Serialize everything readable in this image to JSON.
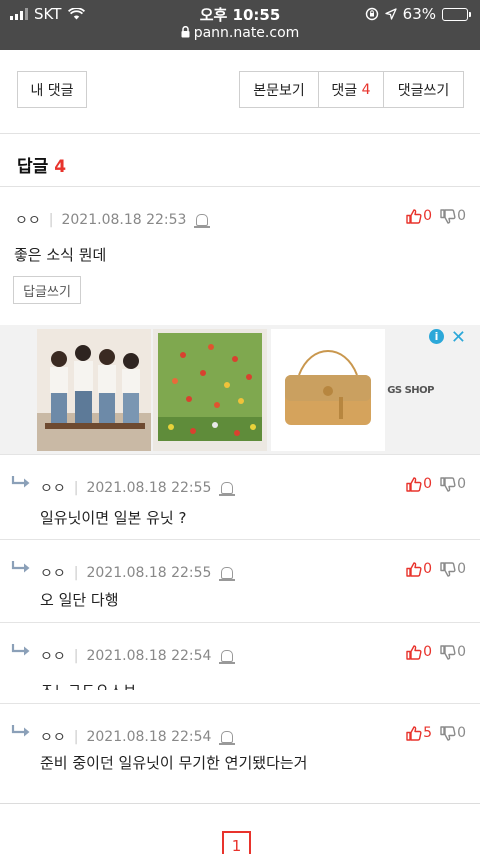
{
  "status_bar": {
    "carrier": "SKT",
    "time": "오후 10:55",
    "url": "pann.nate.com",
    "battery": "63%",
    "battery_level": 0.63
  },
  "toolbar": {
    "my_comments": "내 댓글",
    "view_post": "본문보기",
    "comments_label": "댓글",
    "comments_count": "4",
    "write_comment": "댓글쓰기"
  },
  "replies_section": {
    "title": "답글",
    "count": "4"
  },
  "comments": [
    {
      "author": "ㅇㅇ",
      "date": "2021.08.18 22:53",
      "text": "좋은 소식 뭔데",
      "up": "0",
      "down": "0",
      "reply_label": "답글쓰기"
    },
    {
      "author": "ㅇㅇ",
      "date": "2021.08.18 22:55",
      "text": "일유닛이면 일본 유닛 ?",
      "up": "0",
      "down": "0"
    },
    {
      "author": "ㅇㅇ",
      "date": "2021.08.18 22:55",
      "text": "오 일단 다행",
      "up": "0",
      "down": "0"
    },
    {
      "author": "ㅇㅇ",
      "date": "2021.08.18 22:54",
      "text": "ㅈㄴㄱㄷㅇㅅㅂ",
      "up": "0",
      "down": "0"
    },
    {
      "author": "ㅇㅇ",
      "date": "2021.08.18 22:54",
      "text": "준비 중이던 일유닛이 무기한 연기됐다는거",
      "up": "5",
      "down": "0"
    }
  ],
  "ad": {
    "brand": "GS SHOP",
    "info_label": "i",
    "close_label": "✕"
  },
  "pagination": {
    "current_page": "1"
  },
  "colors": {
    "accent": "#e8332c",
    "status_bar": "#4a4a4a",
    "ad_blue": "#2ca8d9"
  }
}
